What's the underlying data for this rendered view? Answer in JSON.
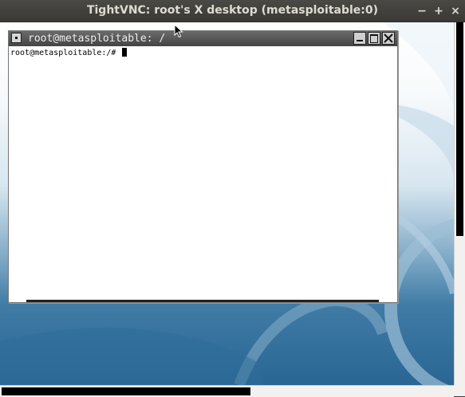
{
  "vnc_window": {
    "title": "TightVNC: root's X desktop (metasploitable:0)",
    "buttons": {
      "minimize": "−",
      "maximize": "+",
      "close": "×"
    }
  },
  "xterm": {
    "title": "root@metasploitable: /",
    "prompt": "root@metasploitable:/# "
  },
  "icons": {
    "window_menu": "window-menu-icon",
    "minimize": "minimize-icon",
    "maximize": "maximize-icon",
    "close": "close-icon",
    "mouse": "mouse-pointer-icon"
  },
  "colors": {
    "titlebar": "#3c3b37",
    "title_text": "#dfdbd2",
    "desktop_blue": "#2a6693"
  }
}
